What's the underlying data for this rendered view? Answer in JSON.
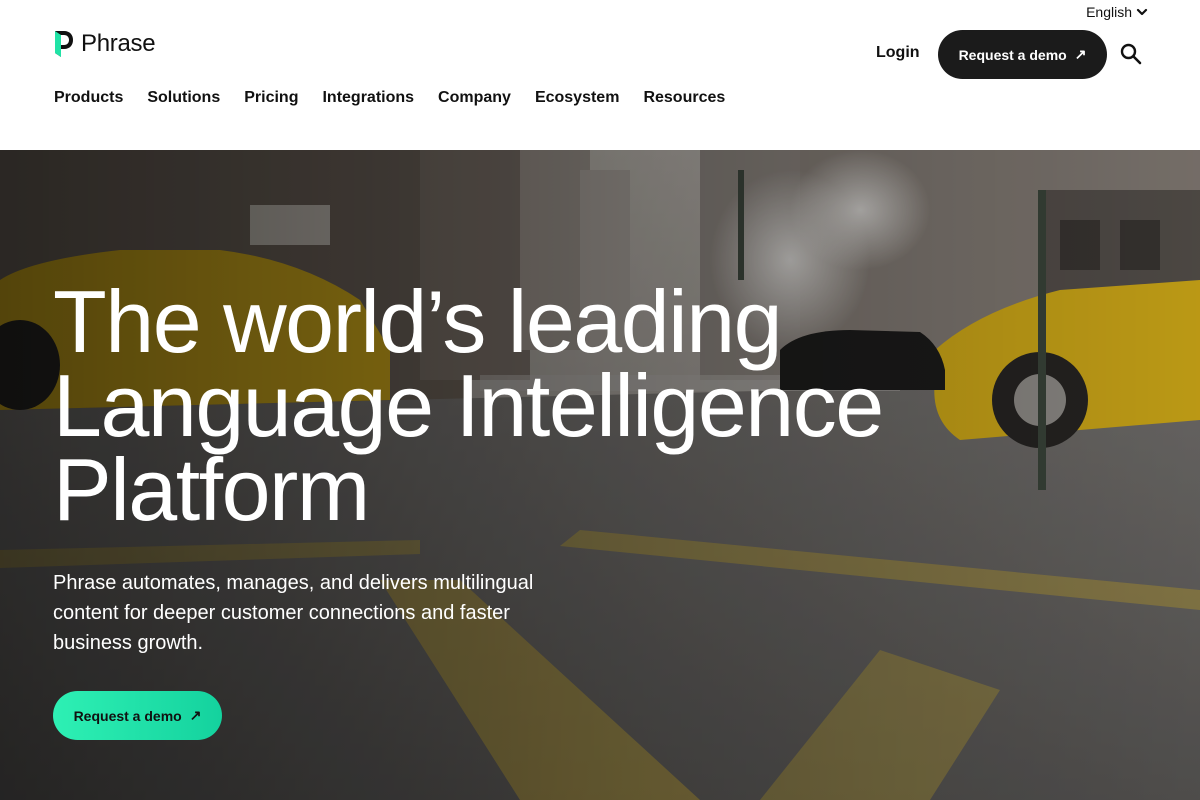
{
  "header": {
    "language": "English",
    "logo_text": "Phrase",
    "nav": [
      "Products",
      "Solutions",
      "Pricing",
      "Integrations",
      "Company",
      "Ecosystem",
      "Resources"
    ],
    "login_label": "Login",
    "demo_label": "Request a demo",
    "arrow": "↗"
  },
  "hero": {
    "title_line1": "The world’s leading",
    "title_line2": "Language Intelligence",
    "title_line3": "Platform",
    "subtitle": "Phrase automates, manages, and delivers multilingual content for deeper customer connections and faster business growth.",
    "cta_label": "Request a demo",
    "cta_arrow": "↗"
  },
  "colors": {
    "accent": "#1ee2a8",
    "dark_button": "#1b1b1b",
    "taxi": "#f2c417"
  },
  "icons": [
    "chevron-down-icon",
    "search-icon",
    "arrow-up-right-icon",
    "phrase-logo-icon"
  ]
}
